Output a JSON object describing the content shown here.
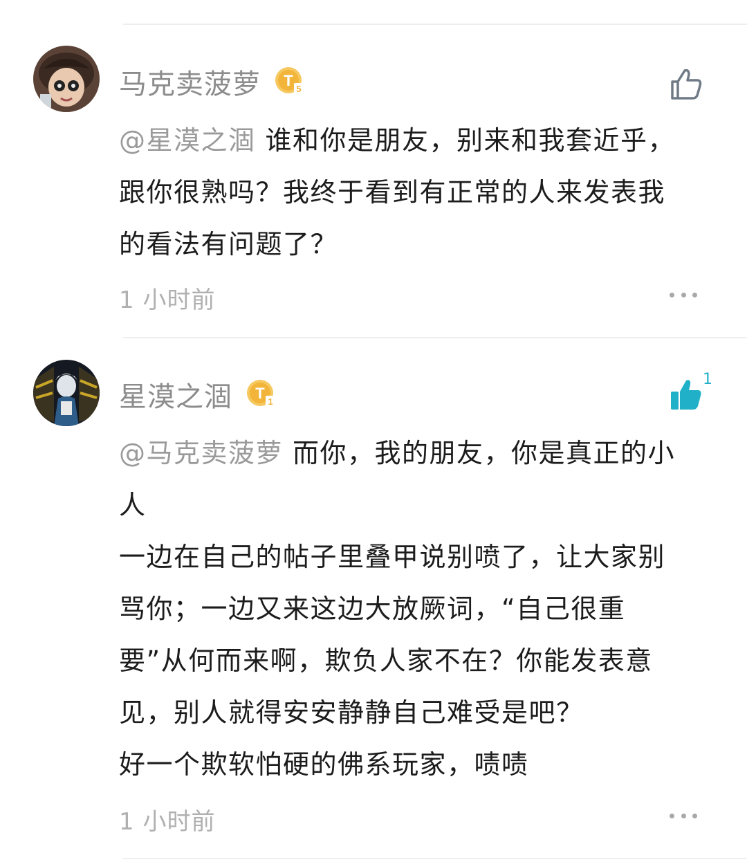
{
  "comments": [
    {
      "username": "马克卖菠萝",
      "level_badge": "T5",
      "mention": "@星漠之涸",
      "lines": [
        "谁和你是朋友，别来和我套近乎，",
        "跟你很熟吗？我终于看到有正常的人来发表我",
        "的看法有问题了？"
      ],
      "timestamp": "1 小时前",
      "like_icon": "thumbs-up-outline-icon",
      "liked": false,
      "like_count": ""
    },
    {
      "username": "星漠之涸",
      "level_badge": "T1",
      "mention": "@马克卖菠萝",
      "lines": [
        "而你，我的朋友，你是真正的小",
        "人",
        "一边在自己的帖子里叠甲说别喷了，让大家别",
        "骂你；一边又来这边大放厥词，“自己很重",
        "要”从何而来啊，欺负人家不在？你能发表意",
        "见，别人就得安安静静自己难受是吧？",
        "好一个欺软怕硬的佛系玩家，啧啧"
      ],
      "timestamp": "1 小时前",
      "like_icon": "thumbs-up-filled-icon",
      "liked": true,
      "like_count": "1"
    }
  ],
  "colors": {
    "username": "#8c8c8c",
    "mention": "#9a9a9a",
    "body": "#1c1c1c",
    "timestamp": "#b0b0b0",
    "liked_accent": "#20b0c8",
    "badge_gold": "#f2b53a",
    "divider": "#eeeeee"
  }
}
